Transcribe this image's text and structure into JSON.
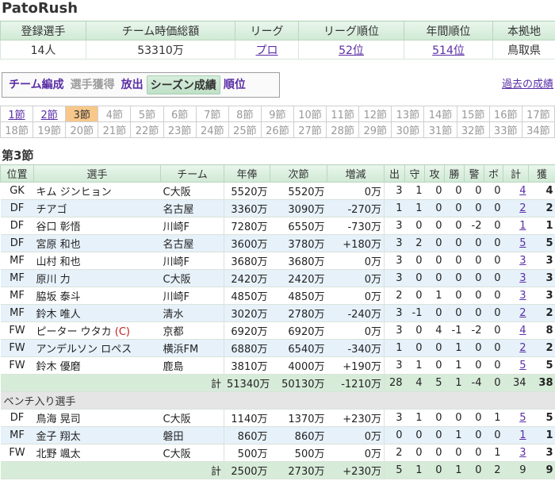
{
  "app": {
    "title": "PatoRush"
  },
  "summary": {
    "headers": [
      "登録選手",
      "チーム時価総額",
      "リーグ",
      "リーグ順位",
      "年間順位",
      "本拠地"
    ],
    "values": [
      "14人",
      "53310万",
      "プロ",
      "52位",
      "514位",
      "鳥取県"
    ]
  },
  "tabs": [
    {
      "label": "チーム編成",
      "state": "link"
    },
    {
      "label": "選手獲得",
      "state": "disabled"
    },
    {
      "label": "放出",
      "state": "link"
    },
    {
      "label": "シーズン成績",
      "state": "active"
    },
    {
      "label": "順位",
      "state": "link"
    }
  ],
  "past_results_link": "過去の成績",
  "rounds": {
    "row1": [
      "1節",
      "2節",
      "3節",
      "4節",
      "5節",
      "6節",
      "7節",
      "8節",
      "9節",
      "10節",
      "11節",
      "12節",
      "13節",
      "14節",
      "15節",
      "16節",
      "17節"
    ],
    "row2": [
      "18節",
      "19節",
      "20節",
      "21節",
      "22節",
      "23節",
      "24節",
      "25節",
      "26節",
      "27節",
      "28節",
      "29節",
      "30節",
      "31節",
      "32節",
      "33節",
      "34節"
    ],
    "current": "3節",
    "linked": [
      "1節",
      "2節"
    ]
  },
  "section_title": "第3節",
  "table": {
    "headers": [
      "位置",
      "選手",
      "チーム",
      "年俸",
      "次節",
      "増減",
      "出",
      "守",
      "攻",
      "勝",
      "警",
      "ボ",
      "計",
      "獲"
    ],
    "starters": [
      [
        "GK",
        "キム ジンヒョン",
        "C大阪",
        "5520万",
        "5520万",
        "0万",
        "3",
        "1",
        "0",
        "0",
        "0",
        "0",
        "4",
        "4"
      ],
      [
        "DF",
        "チアゴ",
        "名古屋",
        "3360万",
        "3090万",
        "-270万",
        "1",
        "1",
        "0",
        "0",
        "0",
        "0",
        "2",
        "2"
      ],
      [
        "DF",
        "谷口 彰悟",
        "川崎F",
        "7280万",
        "6550万",
        "-730万",
        "3",
        "0",
        "0",
        "0",
        "-2",
        "0",
        "1",
        "1"
      ],
      [
        "DF",
        "宮原 和也",
        "名古屋",
        "3600万",
        "3780万",
        "+180万",
        "3",
        "2",
        "0",
        "0",
        "0",
        "0",
        "5",
        "5"
      ],
      [
        "MF",
        "山村 和也",
        "川崎F",
        "3680万",
        "3680万",
        "0万",
        "3",
        "0",
        "0",
        "0",
        "0",
        "0",
        "3",
        "3"
      ],
      [
        "MF",
        "原川 力",
        "C大阪",
        "2420万",
        "2420万",
        "0万",
        "3",
        "0",
        "0",
        "0",
        "0",
        "0",
        "3",
        "3"
      ],
      [
        "MF",
        "脇坂 泰斗",
        "川崎F",
        "4850万",
        "4850万",
        "0万",
        "2",
        "0",
        "1",
        "0",
        "0",
        "0",
        "3",
        "3"
      ],
      [
        "MF",
        "鈴木 唯人",
        "清水",
        "3020万",
        "2780万",
        "-240万",
        "3",
        "-1",
        "0",
        "0",
        "0",
        "0",
        "2",
        "2"
      ],
      [
        "FW",
        "ピーター ウタカ",
        "京都",
        "6920万",
        "6920万",
        "0万",
        "3",
        "0",
        "4",
        "-1",
        "-2",
        "0",
        "4",
        "8"
      ],
      [
        "FW",
        "アンデルソン ロペス",
        "横浜FM",
        "6880万",
        "6540万",
        "-340万",
        "1",
        "0",
        "0",
        "1",
        "0",
        "0",
        "2",
        "2"
      ],
      [
        "FW",
        "鈴木 優磨",
        "鹿島",
        "3810万",
        "4000万",
        "+190万",
        "3",
        "1",
        "0",
        "1",
        "0",
        "0",
        "5",
        "5"
      ]
    ],
    "captain_mark": "(C)",
    "captain_row": 8,
    "starters_total": [
      "計",
      "51340万",
      "50130万",
      "-1210万",
      "28",
      "4",
      "5",
      "1",
      "-4",
      "0",
      "34",
      "38"
    ],
    "bench_title": "ベンチ入り選手",
    "bench": [
      [
        "DF",
        "鳥海 晃司",
        "C大阪",
        "1140万",
        "1370万",
        "+230万",
        "3",
        "1",
        "0",
        "0",
        "0",
        "1",
        "5",
        "5"
      ],
      [
        "MF",
        "金子 翔太",
        "磐田",
        "860万",
        "860万",
        "0万",
        "0",
        "0",
        "0",
        "1",
        "0",
        "0",
        "1",
        "1"
      ],
      [
        "FW",
        "北野 颯太",
        "C大阪",
        "500万",
        "500万",
        "0万",
        "2",
        "0",
        "0",
        "0",
        "0",
        "1",
        "3",
        "3"
      ]
    ],
    "bench_total": [
      "計",
      "2500万",
      "2730万",
      "+230万",
      "5",
      "1",
      "0",
      "1",
      "0",
      "2",
      "9",
      "9"
    ]
  }
}
